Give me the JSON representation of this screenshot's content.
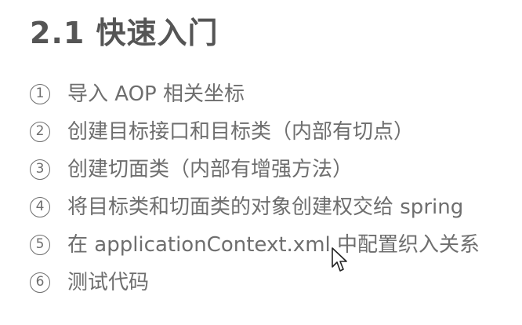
{
  "slide": {
    "title": "2.1 快速入门",
    "steps": [
      {
        "number": "1",
        "text": "导入 AOP 相关坐标"
      },
      {
        "number": "2",
        "text": "创建目标接口和目标类（内部有切点）"
      },
      {
        "number": "3",
        "text": "创建切面类（内部有增强方法）"
      },
      {
        "number": "4",
        "text": "将目标类和切面类的对象创建权交给 spring"
      },
      {
        "number": "5",
        "text": "在 applicationContext.xml 中配置织入关系"
      },
      {
        "number": "6",
        "text": "测试代码"
      }
    ]
  },
  "cursor": {
    "icon": "mouse-pointer-icon"
  },
  "colors": {
    "title": "#555555",
    "text": "#6e6e6e",
    "background": "#ffffff"
  }
}
